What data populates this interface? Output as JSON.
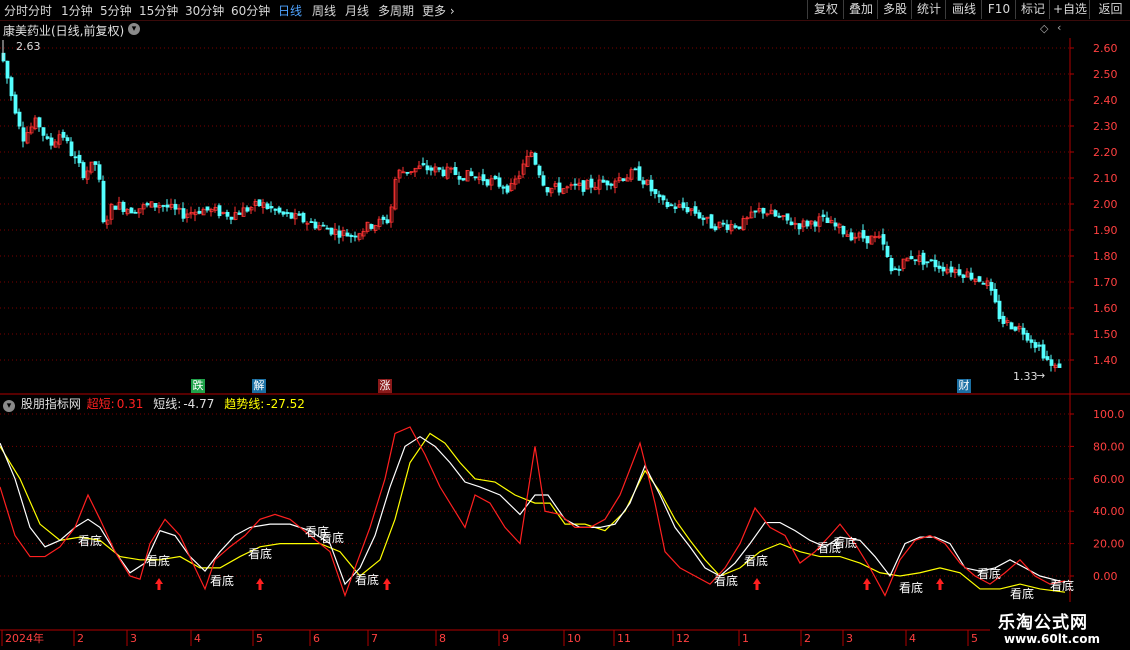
{
  "toolbar": {
    "tabs": [
      {
        "label": "分时",
        "active": false
      },
      {
        "label": "1分钟",
        "active": false
      },
      {
        "label": "5分钟",
        "active": false
      },
      {
        "label": "15分钟",
        "active": false
      },
      {
        "label": "30分钟",
        "active": false
      },
      {
        "label": "60分钟",
        "active": false
      },
      {
        "label": "日线",
        "active": true
      },
      {
        "label": "周线",
        "active": false
      },
      {
        "label": "月线",
        "active": false
      },
      {
        "label": "多周期",
        "active": false
      },
      {
        "label": "更多",
        "active": false
      }
    ],
    "right_buttons": [
      "复权",
      "叠加",
      "多股",
      "统计",
      "画线",
      "F10",
      "标记",
      "+自选",
      "返回"
    ]
  },
  "chart_title": "康美药业(日线,前复权)",
  "price_axis": {
    "ticks": [
      "2.60",
      "2.50",
      "2.40",
      "2.30",
      "2.20",
      "2.10",
      "2.00",
      "1.90",
      "1.80",
      "1.70",
      "1.60",
      "1.50",
      "1.40"
    ]
  },
  "price_labels": {
    "high": "2.63",
    "low": "1.33"
  },
  "event_markers": [
    {
      "label": "跌",
      "color": "#1fa34a"
    },
    {
      "label": "解",
      "color": "#1b6fa3"
    },
    {
      "label": "涨",
      "color": "#a31f1f"
    },
    {
      "label": "财",
      "color": "#1b6fa3"
    }
  ],
  "indicator": {
    "name": "股朋指标网",
    "super_short_label": "超短:",
    "super_short_value": "0.31",
    "short_label": "短线:",
    "short_value": "-4.77",
    "trend_label": "趋势线:",
    "trend_value": "-27.52",
    "colors": {
      "super_short": "#ff2020",
      "short": "#ffffff",
      "trend": "#ffff00"
    },
    "ticks": [
      "100.0",
      "80.00",
      "60.00",
      "40.00",
      "20.00",
      "0.00"
    ],
    "signal_text": "看底"
  },
  "time_axis": {
    "labels": [
      "2024年",
      "2",
      "3",
      "4",
      "5",
      "6",
      "7",
      "8",
      "9",
      "10",
      "11",
      "12",
      "1",
      "2",
      "3",
      "4",
      "5"
    ]
  },
  "watermark": {
    "title": "乐淘公式网",
    "url": "www.60lt.com"
  },
  "colors": {
    "up": "#ff3232",
    "down": "#54ffff",
    "grid": "#7a0000",
    "axis": "#b00000"
  },
  "chart_data": {
    "type": "candlestick",
    "price_range": [
      1.33,
      2.63
    ],
    "indicator_range": [
      -10,
      100
    ]
  }
}
